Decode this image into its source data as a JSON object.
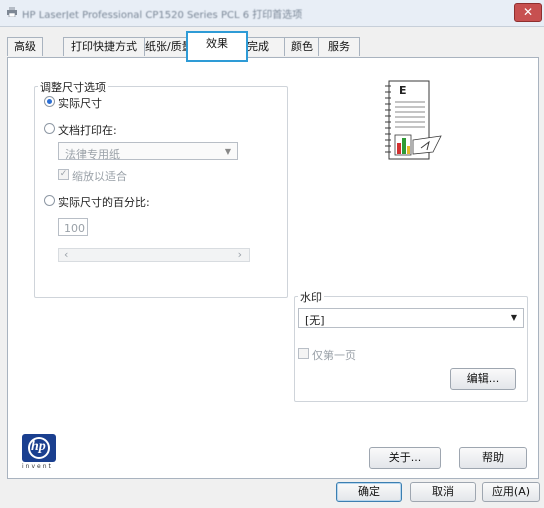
{
  "window": {
    "title": "HP LaserJet Professional CP1520 Series PCL 6 打印首选项",
    "close_label": "✕"
  },
  "tabs": [
    {
      "label": "高级"
    },
    {
      "label": "打印快捷方式"
    },
    {
      "label": "纸张/质量"
    },
    {
      "label": "效果"
    },
    {
      "label": "完成"
    },
    {
      "label": "颜色"
    },
    {
      "label": "服务"
    }
  ],
  "resize": {
    "group_label": "调整尺寸选项",
    "actual_size": "实际尺寸",
    "print_on": "文档打印在:",
    "paper": "法律专用纸",
    "scale_to_fit": "缩放以适合",
    "percent": "实际尺寸的百分比:",
    "percent_value": "100",
    "scroll_left": "‹",
    "scroll_right": "›"
  },
  "watermark": {
    "label": "水印",
    "value": "[无]",
    "first_page_only": "仅第一页",
    "edit_button": "编辑..."
  },
  "bottom": {
    "about_button": "关于...",
    "help_button": "帮助",
    "ok_button": "确定",
    "cancel_button": "取消",
    "apply_button": "应用(A)"
  },
  "logo": {
    "brand": "hp",
    "tagline": "invent",
    "brand_color": "#1a3f8f"
  },
  "preview": {
    "letter": "E"
  },
  "colors": {
    "accent": "#2e9bd6",
    "title_bar": "#e8eef6",
    "close": "#c75050"
  }
}
